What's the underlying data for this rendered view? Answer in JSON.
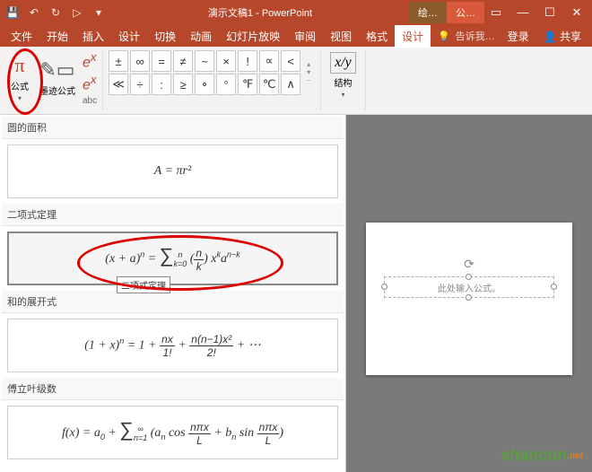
{
  "titlebar": {
    "doc_title": "演示文稿1 - PowerPoint",
    "ctx_draw": "绘…",
    "ctx_eq": "公…"
  },
  "tabs": {
    "file": "文件",
    "home": "开始",
    "insert": "插入",
    "design": "设计",
    "transition": "切换",
    "animation": "动画",
    "slideshow": "幻灯片放映",
    "review": "审阅",
    "view": "视图",
    "format": "格式",
    "eqdesign": "设计",
    "tellme": "告诉我…",
    "signin": "登录",
    "share": "共享"
  },
  "ribbon": {
    "equation_label": "公式",
    "ink_label": "墨迹公式",
    "ex1": "e",
    "ex2": "e",
    "conv_label": "abc",
    "symbols": [
      "±",
      "∞",
      "=",
      "≠",
      "~",
      "×",
      "!",
      "∝",
      "<",
      "≪",
      "÷",
      ":",
      "≥",
      "∘",
      "°",
      "℉",
      "℃",
      "∧"
    ],
    "struct_icon": "x/y",
    "struct_label": "结构"
  },
  "gallery": {
    "section1": "圆的面积",
    "eq1": "A = πr²",
    "section2": "二项式定理",
    "eq2_tooltip": "二项式定理",
    "section3": "和的展开式",
    "section4": "傅立叶级数"
  },
  "slide": {
    "placeholder": "此处输入公式。"
  },
  "watermark": {
    "text1": "shan",
    "text2": "cun",
    "suffix": ".net"
  }
}
